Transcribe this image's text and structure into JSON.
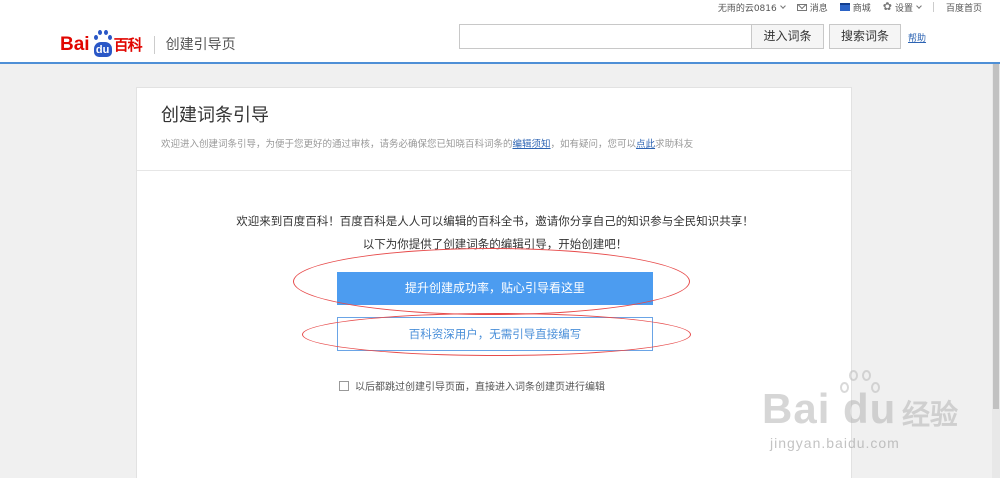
{
  "topbar": {
    "user": "无雨的云0816",
    "messages": "消息",
    "mall": "商城",
    "settings": "设置",
    "home": "百度首页"
  },
  "header": {
    "logo_bai": "Bai",
    "logo_du": "du",
    "logo_baike": "百科",
    "subtitle": "创建引导页",
    "search_placeholder": "",
    "enter_entry_button": "进入词条",
    "search_entry_button": "搜索词条",
    "help_link": "帮助"
  },
  "card": {
    "title": "创建词条引导",
    "desc_prefix": "欢迎进入创建词条引导，为便于您更好的通过审核，请务必确保您已知晓百科词条的",
    "desc_link1": "编辑须知",
    "desc_middle": "，如有疑问，您可以",
    "desc_link2": "点此",
    "desc_suffix": "求助科友",
    "welcome_line1": "欢迎来到百度百科！百度百科是人人可以编辑的百科全书，邀请你分享自己的知识参与全民知识共享！",
    "welcome_line2": "以下为你提供了创建词条的编辑引导，开始创建吧！",
    "primary_button": "提升创建成功率，贴心引导看这里",
    "secondary_button": "百科资深用户，无需引导直接编写",
    "skip_label": "以后都跳过创建引导页面，直接进入词条创建页进行编辑",
    "skip_checked": false
  },
  "watermark": {
    "brand": "Bai du",
    "cn": "经验",
    "url": "jingyan.baidu.com"
  },
  "colors": {
    "brand_red": "#e10601",
    "brand_blue": "#2a57c6",
    "primary_button": "#4c9cf0",
    "link": "#2d64b3",
    "annotation": "#e74c4c"
  }
}
